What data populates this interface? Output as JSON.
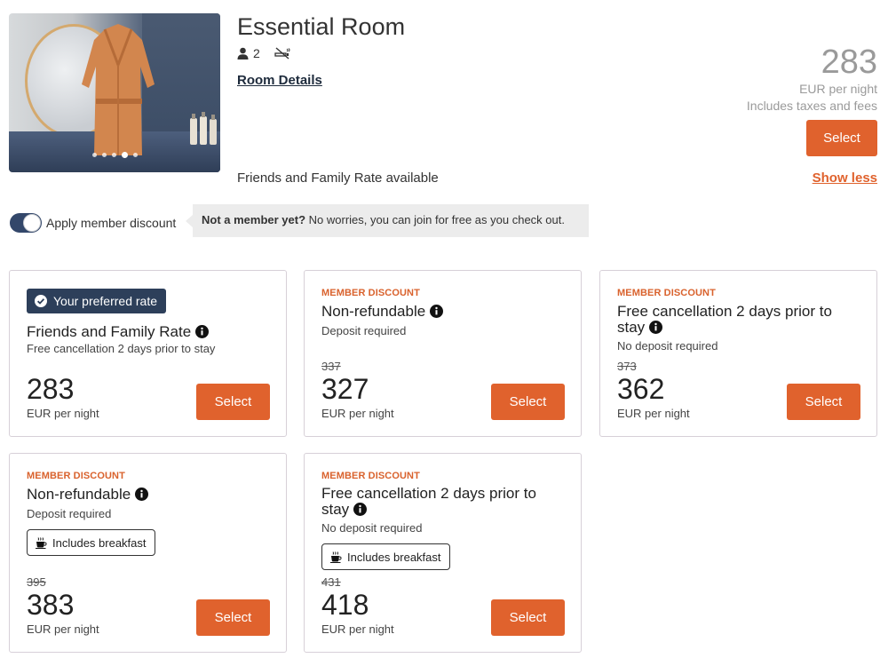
{
  "room": {
    "title": "Essential Room",
    "guests": "2",
    "details_link": "Room Details",
    "rate_note": "Friends and Family Rate available",
    "image_dots": 5,
    "image_active_dot": 4
  },
  "summary": {
    "price": "283",
    "per_night": "EUR per night",
    "taxes": "Includes taxes and fees",
    "select_label": "Select",
    "show_less": "Show less"
  },
  "member": {
    "toggle_label": "Apply member discount",
    "toggle_on": true,
    "callout_bold": "Not a member yet?",
    "callout_text": " No worries, you can join for free as you check out."
  },
  "rates": [
    {
      "badge": "Your preferred rate",
      "name": "Friends and Family Rate",
      "sub": "Free cancellation 2 days prior to stay",
      "price": "283",
      "per_night": "EUR per night",
      "select_label": "Select"
    },
    {
      "eyebrow": "MEMBER DISCOUNT",
      "name": "Non-refundable",
      "sub": "Deposit required",
      "old_price": "337",
      "price": "327",
      "per_night": "EUR per night",
      "select_label": "Select"
    },
    {
      "eyebrow": "MEMBER DISCOUNT",
      "name": "Free cancellation 2 days prior to stay",
      "sub": "No deposit required",
      "old_price": "373",
      "price": "362",
      "per_night": "EUR per night",
      "select_label": "Select"
    },
    {
      "eyebrow": "MEMBER DISCOUNT",
      "name": "Non-refundable",
      "sub": "Deposit required",
      "chip": "Includes breakfast",
      "old_price": "395",
      "price": "383",
      "per_night": "EUR per night",
      "select_label": "Select"
    },
    {
      "eyebrow": "MEMBER DISCOUNT",
      "name": "Free cancellation 2 days prior to stay",
      "sub": "No deposit required",
      "chip": "Includes breakfast",
      "old_price": "431",
      "price": "418",
      "per_night": "EUR per night",
      "select_label": "Select"
    }
  ],
  "colors": {
    "accent": "#e0622d",
    "navy": "#2d3f5a",
    "eyebrow": "#d9622d",
    "muted": "#9a9a9a"
  },
  "icons": {
    "guests": "person-icon",
    "no_smoking": "no-smoking-icon",
    "info": "info-icon",
    "check": "check-circle-icon",
    "breakfast": "coffee-cup-icon"
  }
}
